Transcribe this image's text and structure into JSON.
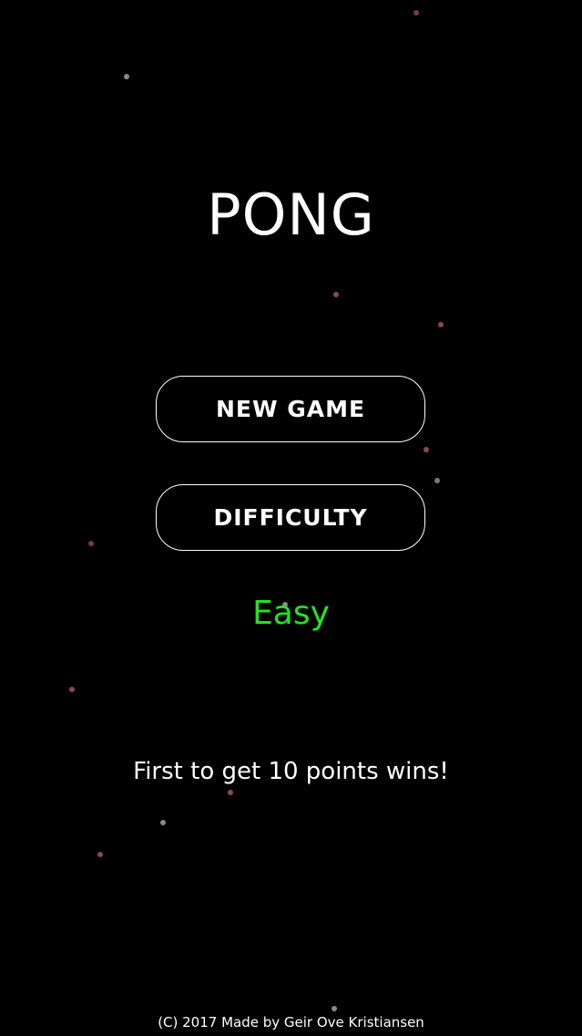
{
  "title": "PONG",
  "menu": {
    "new_game_label": "NEW GAME",
    "difficulty_label": "DIFFICULTY"
  },
  "difficulty": {
    "value": "Easy",
    "color": "#22e322"
  },
  "rules_text": "First to get 10 points wins!",
  "copyright": "(C) 2017 Made by Geir Ove Kristiansen",
  "colors": {
    "background": "#000000",
    "text": "#ffffff",
    "particle_red": "#8a4a4a",
    "particle_gray": "#8a8a8a"
  }
}
